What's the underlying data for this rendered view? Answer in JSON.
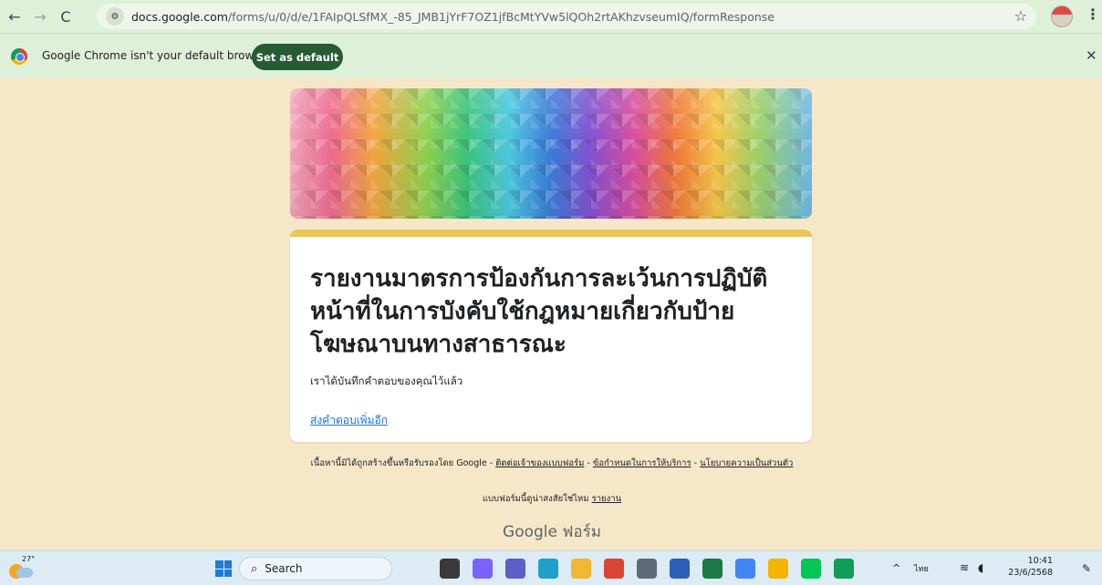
{
  "browser": {
    "url_host": "docs.google.com",
    "url_path": "/forms/u/0/d/e/1FAIpQLSfMX_-85_JMB1jYrF7OZ1jfBcMtYVw5lQOh2rtAKhzvseumIQ/formResponse"
  },
  "infobar": {
    "message": "Google Chrome isn't your default browser",
    "button_label": "Set as default"
  },
  "form": {
    "title": "รายงานมาตรการป้องกันการละเว้นการปฏิบัติหน้าที่ในการบังคับใช้กฎหมายเกี่ยวกับป้ายโฆษณาบนทางสาธารณะ",
    "confirmation": "เราได้บันทึกคำตอบของคุณไว้แล้ว",
    "another_response_link": "ส่งคำตอบเพิ่มอีก"
  },
  "footer": {
    "disclaimer": "เนื้อหานี้มิได้ถูกสร้างขึ้นหรือรับรองโดย Google -",
    "contact_owner": "ติดต่อเจ้าของแบบฟอร์ม",
    "terms": "ข้อกำหนดในการให้บริการ",
    "privacy": "นโยบายความเป็นส่วนตัว",
    "suspicious": "แบบฟอร์มนี้ดูน่าสงสัยใช่ไหม",
    "report": "รายงาน",
    "brand": "Google ฟอร์ม"
  },
  "taskbar": {
    "temperature": "27°",
    "search_label": "Search",
    "language": "ไทย",
    "time": "10:41",
    "date": "23/6/2568",
    "apps": [
      {
        "name": "file-explorer",
        "color": "#3a3a3a"
      },
      {
        "name": "copilot",
        "color": "#7b61ff"
      },
      {
        "name": "teams",
        "color": "#5b5fc7"
      },
      {
        "name": "edge",
        "color": "#1fa0c9"
      },
      {
        "name": "folder",
        "color": "#f2b632"
      },
      {
        "name": "chrome",
        "color": "#db4437"
      },
      {
        "name": "calculator",
        "color": "#5d6b78"
      },
      {
        "name": "word",
        "color": "#2b5fb8"
      },
      {
        "name": "excel",
        "color": "#1d7a45"
      },
      {
        "name": "chrome-2",
        "color": "#4285f4"
      },
      {
        "name": "slides",
        "color": "#f4b400"
      },
      {
        "name": "line",
        "color": "#06c755"
      },
      {
        "name": "chrome-3",
        "color": "#0f9d58"
      }
    ]
  }
}
